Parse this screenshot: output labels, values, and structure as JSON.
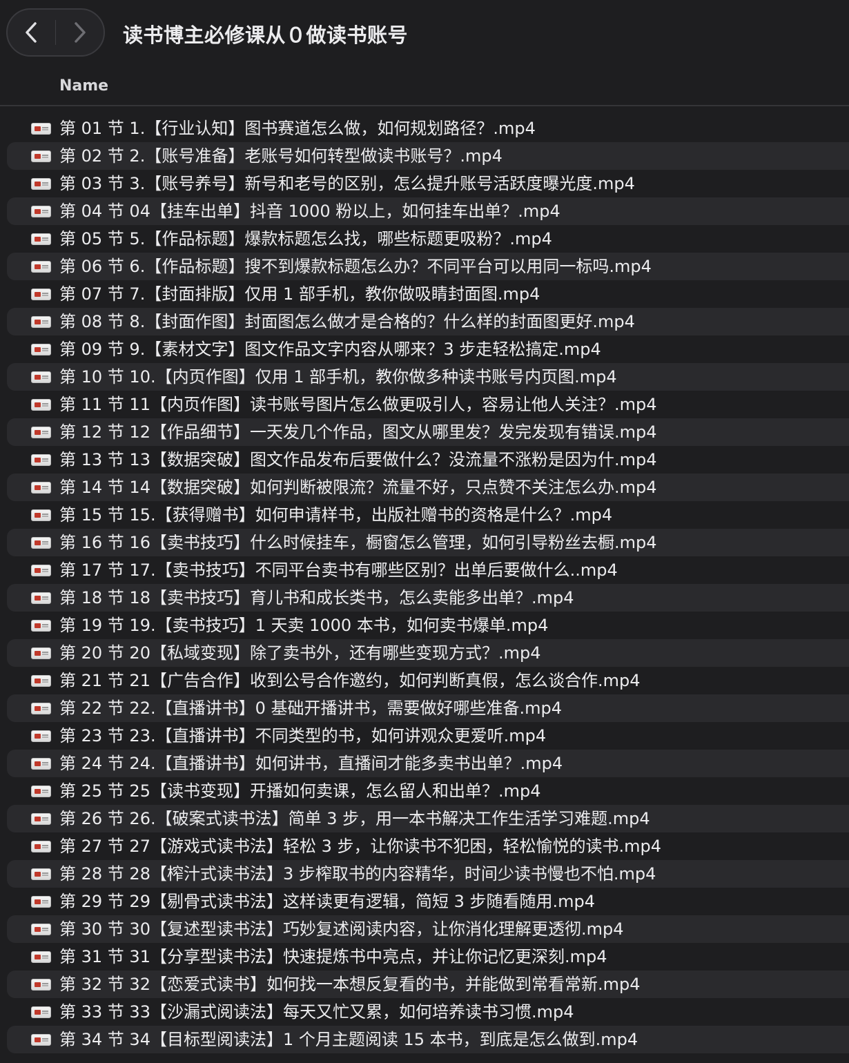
{
  "window": {
    "title": "读书博主必修课从０做读书账号"
  },
  "columns": {
    "name": "Name"
  },
  "files": [
    "第 01 节 1.【行业认知】图书赛道怎么做，如何规划路径？.mp4",
    "第 02 节 2.【账号准备】老账号如何转型做读书账号？.mp4",
    "第 03 节 3.【账号养号】新号和老号的区别，怎么提升账号活跃度曝光度.mp4",
    "第 04 节 04【挂车出单】抖音 1000 粉以上，如何挂车出单？.mp4",
    "第 05 节 5.【作品标题】爆款标题怎么找，哪些标题更吸粉？.mp4",
    "第 06 节 6.【作品标题】搜不到爆款标题怎么办？不同平台可以用同一标吗.mp4",
    "第 07 节 7.【封面排版】仅用 1 部手机，教你做吸睛封面图.mp4",
    "第 08 节 8.【封面作图】封面图怎么做才是合格的？什么样的封面图更好.mp4",
    "第 09 节 9.【素材文字】图文作品文字内容从哪来？3 步走轻松搞定.mp4",
    "第 10 节 10.【内页作图】仅用 1 部手机，教你做多种读书账号内页图.mp4",
    "第 11 节 11【内页作图】读书账号图片怎么做更吸引人，容易让他人关注？.mp4",
    "第 12 节 12【作品细节】一天发几个作品，图文从哪里发？发完发现有错误.mp4",
    "第 13 节 13【数据突破】图文作品发布后要做什么？没流量不涨粉是因为什.mp4",
    "第 14 节 14【数据突破】如何判断被限流？流量不好，只点赞不关注怎么办.mp4",
    "第 15 节 15.【获得赠书】如何申请样书，出版社赠书的资格是什么？.mp4",
    "第 16 节 16【卖书技巧】什么时候挂车，橱窗怎么管理，如何引导粉丝去橱.mp4",
    "第 17 节 17.【卖书技巧】不同平台卖书有哪些区别？出单后要做什么..mp4",
    "第 18 节 18【卖书技巧】育儿书和成长类书，怎么卖能多出单？.mp4",
    "第 19 节 19.【卖书技巧】1 天卖 1000 本书，如何卖书爆单.mp4",
    "第 20 节 20【私域变现】除了卖书外，还有哪些变现方式？.mp4",
    "第 21 节 21【广告合作】收到公号合作邀约，如何判断真假，怎么谈合作.mp4",
    "第 22 节 22.【直播讲书】0 基础开播讲书，需要做好哪些准备.mp4",
    "第 23 节 23.【直播讲书】不同类型的书，如何讲观众更爱听.mp4",
    "第 24 节 24.【直播讲书】如何讲书，直播间才能多卖书出单？.mp4",
    "第 25 节 25【读书变现】开播如何卖课，怎么留人和出单？.mp4",
    "第 26 节 26.【破案式读书法】简单 3 步，用一本书解决工作生活学习难题.mp4",
    "第 27 节 27【游戏式读书法】轻松 3 步，让你读书不犯困，轻松愉悦的读书.mp4",
    "第 28 节 28【榨汁式读书法】3 步榨取书的内容精华，时间少读书慢也不怕.mp4",
    "第 29 节 29【剔骨式读书法】这样读更有逻辑，简短 3 步随看随用.mp4",
    "第 30 节 30【复述型读书法】巧妙复述阅读内容，让你消化理解更透彻.mp4",
    "第 31 节 31【分享型读书法】快速提炼书中亮点，并让你记忆更深刻.mp4",
    "第 32 节 32【恋爱式读书】如何找一本想反复看的书，并能做到常看常新.mp4",
    "第 33 节 33【沙漏式阅读法】每天又忙又累，如何培养读书习惯.mp4",
    "第 34 节 34【目标型阅读法】1 个月主题阅读 15 本书，到底是怎么做到.mp4"
  ]
}
